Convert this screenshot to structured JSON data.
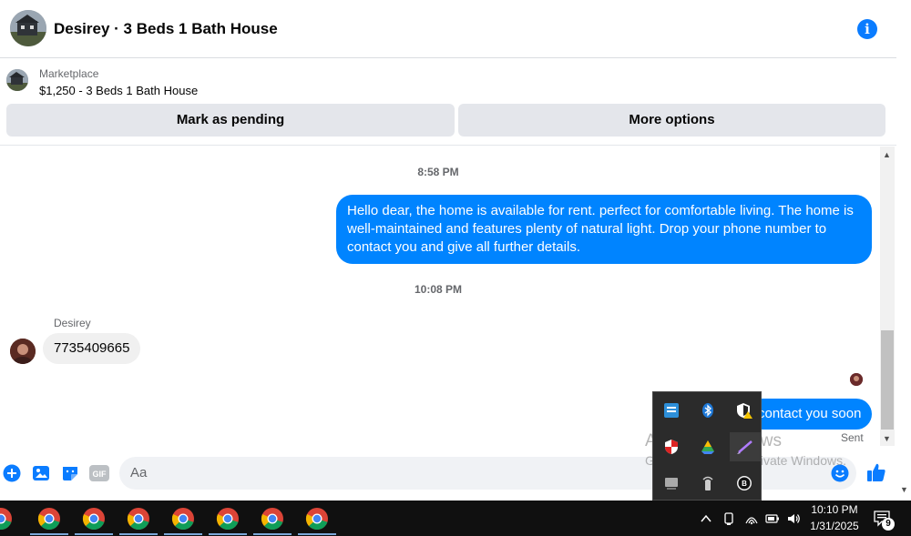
{
  "header": {
    "title": "Desirey · 3 Beds 1 Bath House",
    "info_icon": "i"
  },
  "marketplace": {
    "label": "Marketplace",
    "listing": "$1,250 - 3 Beds 1 Bath House",
    "buttons": {
      "pending": "Mark as pending",
      "options": "More options"
    }
  },
  "conversation": {
    "timestamp_1": "8:58 PM",
    "outgoing_1": "Hello dear,  the home is available for rent. perfect for comfortable living. The home is well-maintained and features plenty of natural light. Drop your phone number to contact you and give all further details.",
    "timestamp_2": "10:08 PM",
    "sender_name": "Desirey",
    "incoming_1": "7735409665",
    "outgoing_2": "contact you soon",
    "status": "Sent"
  },
  "composer": {
    "placeholder": "Aa",
    "gif_label": "GIF"
  },
  "watermark": {
    "line1": "Activate Windows",
    "line2": "Go to Settings to activate Windows."
  },
  "taskbar": {
    "time": "10:10 PM",
    "date": "1/31/2025",
    "notification_count": "9"
  },
  "colors": {
    "messenger_blue": "#0084ff",
    "accent_blue": "#0a7cff",
    "button_gray": "#e4e6eb",
    "incoming_bubble": "#f0f0f0",
    "taskbar": "#101010"
  },
  "icons": [
    "info-icon",
    "plus-icon",
    "photo-icon",
    "sticker-icon",
    "gif-icon",
    "emoji-icon",
    "like-icon",
    "chrome-icon",
    "chevron-up-icon",
    "wifi-icon",
    "battery-icon",
    "volume-icon",
    "notification-icon"
  ]
}
